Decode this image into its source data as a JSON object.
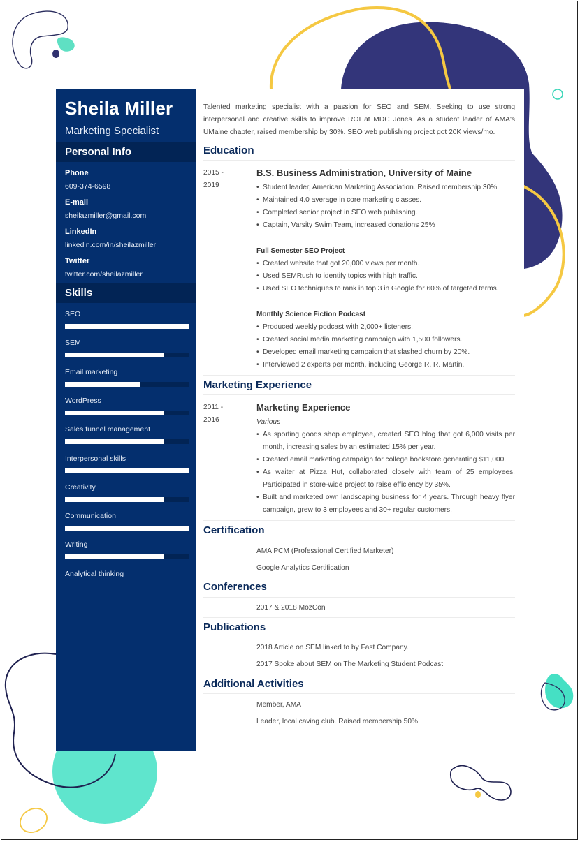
{
  "header": {
    "name": "Sheila Miller",
    "title": "Marketing Specialist"
  },
  "personal_info": {
    "heading": "Personal Info",
    "items": [
      {
        "label": "Phone",
        "value": "609-374-6598"
      },
      {
        "label": "E-mail",
        "value": "sheilazmiller@gmail.com"
      },
      {
        "label": "LinkedIn",
        "value": "linkedin.com/in/sheilazmiller"
      },
      {
        "label": "Twitter",
        "value": "twitter.com/sheilazmiller"
      }
    ]
  },
  "skills": {
    "heading": "Skills",
    "items": [
      {
        "name": "SEO",
        "level": 1.0
      },
      {
        "name": "SEM",
        "level": 0.8
      },
      {
        "name": "Email marketing",
        "level": 0.6
      },
      {
        "name": "WordPress",
        "level": 0.8
      },
      {
        "name": "Sales funnel management",
        "level": 0.8
      },
      {
        "name": "Interpersonal skills",
        "level": 1.0
      },
      {
        "name": "Creativity,",
        "level": 0.8
      },
      {
        "name": "Communication",
        "level": 1.0
      },
      {
        "name": "Writing",
        "level": 0.8
      },
      {
        "name": "Analytical thinking",
        "level": null
      }
    ]
  },
  "summary": "Talented marketing specialist with a passion for SEO and SEM. Seeking to use strong interpersonal and creative skills to improve ROI at MDC Jones. As a student leader of AMA's UMaine chapter, raised membership by 30%. SEO web publishing project got 20K views/mo.",
  "education": {
    "heading": "Education",
    "date_start": "2015 -",
    "date_end": "2019",
    "degree": "B.S. Business Administration, University of Maine",
    "bullets": [
      "Student leader, American Marketing Association. Raised membership 30%.",
      "Maintained 4.0 average in core marketing classes.",
      "Completed senior project in SEO web publishing.",
      "Captain, Varsity Swim Team, increased donations 25%"
    ],
    "projects": [
      {
        "title": "Full Semester SEO Project",
        "bullets": [
          "Created website that got 20,000 views per month.",
          "Used SEMRush to identify topics with high traffic.",
          "Used SEO techniques to rank in top 3 in Google for 60% of targeted terms."
        ]
      },
      {
        "title": "Monthly Science Fiction Podcast",
        "bullets": [
          "Produced weekly podcast with 2,000+ listeners.",
          "Created social media marketing campaign with 1,500 followers.",
          "Developed email marketing campaign that slashed churn by 20%.",
          "Interviewed 2 experts per month, including George R. R. Martin."
        ]
      }
    ]
  },
  "experience": {
    "heading": "Marketing Experience",
    "date_start": "2011 -",
    "date_end": "2016",
    "title": "Marketing Experience",
    "company": "Various",
    "bullets": [
      "As sporting goods shop employee, created SEO blog that got 6,000 visits per month, increasing sales by an estimated 15% per year.",
      "Created email marketing campaign for college bookstore generating $11,000.",
      "As waiter at Pizza Hut, collaborated closely with team of 25 employees. Participated in store-wide project to raise efficiency by 35%.",
      "Built and marketed own landscaping business for 4 years. Through heavy flyer campaign, grew to 3 employees and 30+ regular customers."
    ]
  },
  "certification": {
    "heading": "Certification",
    "items": [
      "AMA PCM (Professional Certified Marketer)",
      "Google Analytics Certification"
    ]
  },
  "conferences": {
    "heading": "Conferences",
    "items": [
      "2017 & 2018 MozCon"
    ]
  },
  "publications": {
    "heading": "Publications",
    "items": [
      "2018 Article on SEM linked to by Fast Company.",
      "2017 Spoke about SEM on The Marketing Student Podcast"
    ]
  },
  "activities": {
    "heading": "Additional Activities",
    "items": [
      "Member, AMA",
      "Leader, local caving club. Raised membership 50%."
    ]
  },
  "colors": {
    "sidebar": "#042f6e",
    "sidebar_header": "#022455",
    "heading": "#0b2a5a",
    "accent_navy": "#2f306e",
    "accent_yellow": "#f5c842",
    "accent_mint": "#45e0c4"
  }
}
